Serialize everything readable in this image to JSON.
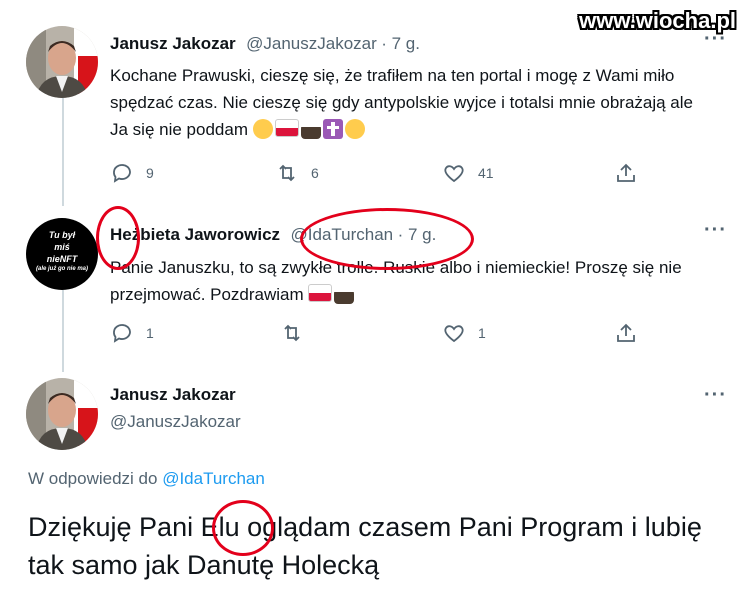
{
  "watermark": "www.wiocha.pl",
  "colors": {
    "accent": "#1d9bf0",
    "annotation": "#e3001b",
    "muted": "#536471"
  },
  "tweet1": {
    "name": "Janusz Jakozar",
    "handle": "@JanuszJakozar",
    "time": "· 7 g.",
    "text": "Kochane Prawuski, cieszę się, że trafiłem na ten portal i mogę z Wami miło spędzać czas. Nie cieszę się gdy antypolskie wyjce i totalsi mnie obrażają ale Ja się nie poddam",
    "emojis": [
      "fist-icon",
      "poland-flag-icon",
      "eagle-icon",
      "cross-icon",
      "fist-icon"
    ],
    "replies": "9",
    "retweets": "6",
    "likes": "41"
  },
  "tweet2": {
    "avatar_text": [
      "Tu był",
      "miś",
      "nieNFT",
      "(ale już go nie ma)"
    ],
    "name": "Hеżbieta Jaworowicz",
    "handle": "@IdaTurchan",
    "time": "· 7 g.",
    "text": "Panie Januszku, to są zwykłe trolle. Ruskie albo i niemieckie! Proszę się nie przejmować. Pozdrawiam",
    "emojis": [
      "poland-flag-icon",
      "eagle-icon"
    ],
    "replies": "1",
    "retweets": "",
    "likes": "1"
  },
  "tweet3": {
    "name": "Janusz Jakozar",
    "handle": "@JanuszJakozar",
    "reply_prefix": "W odpowiedzi do",
    "reply_to": "@IdaTurchan",
    "text_before": "Dziękuję Pani ",
    "highlight": "Elu",
    "text_after": " oglądam czasem Pani Program i lubię tak samo jak Danutę Holecką"
  }
}
